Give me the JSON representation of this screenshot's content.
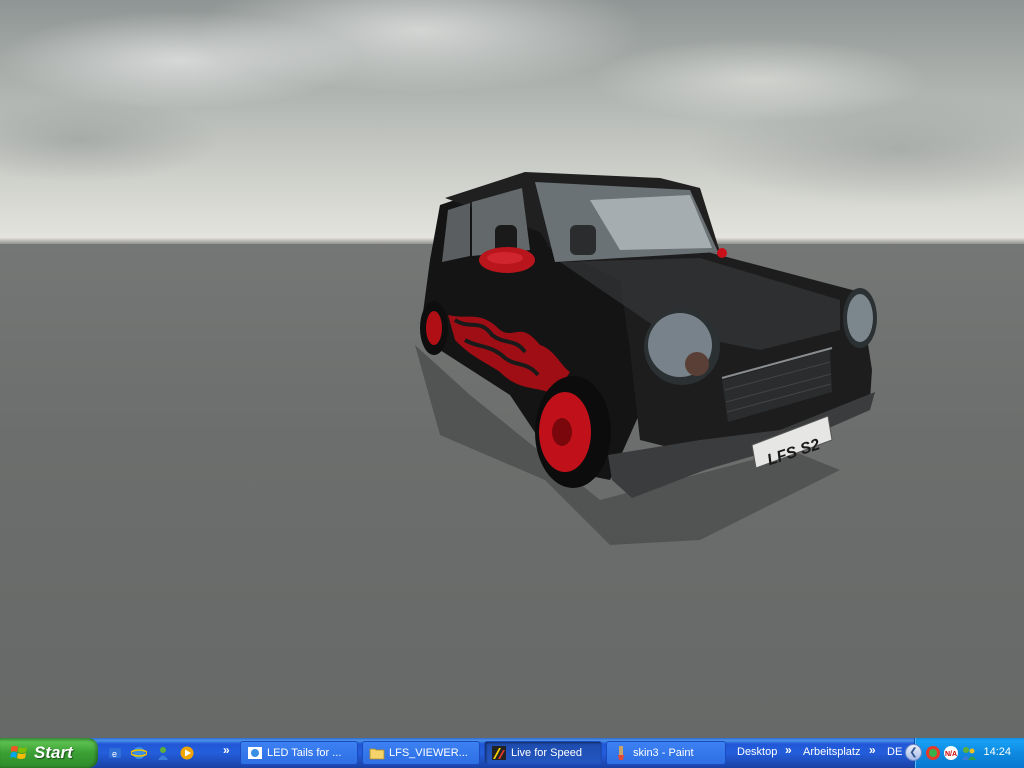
{
  "scene": {
    "plate_text": "LFS S2"
  },
  "taskbar": {
    "start_label": "Start",
    "quick_launch": [
      "outlook-icon",
      "internet-explorer-icon",
      "messenger-icon",
      "media-player-icon"
    ],
    "overflow": "»",
    "tasks": [
      {
        "label": "LED Tails for ...",
        "icon": "browser-icon",
        "active": false
      },
      {
        "label": "LFS_VIEWER...",
        "icon": "folder-icon",
        "active": false
      },
      {
        "label": "Live for Speed",
        "icon": "lfs-icon",
        "active": true
      },
      {
        "label": "skin3 - Paint",
        "icon": "paint-icon",
        "active": false
      }
    ],
    "toolbars": {
      "desktop": "Desktop",
      "arbeitsplatz": "Arbeitsplatz"
    },
    "language": "DE",
    "clock": "14:24"
  },
  "colors": {
    "taskbar_blue": "#245edb",
    "start_green": "#3a9f34",
    "tray_blue": "#0d8ae0",
    "car_body": "#151515",
    "car_accent_red": "#c8101a"
  }
}
